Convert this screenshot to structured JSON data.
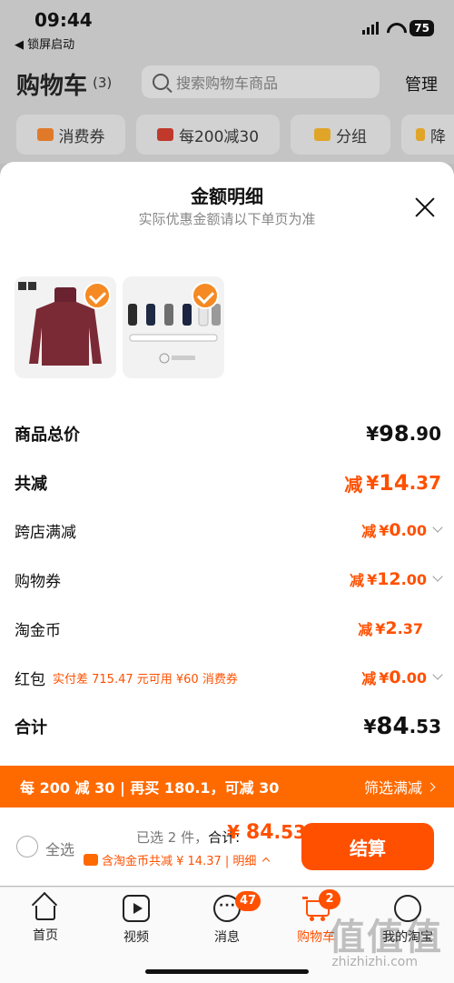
{
  "status_bar": {
    "time": "09:44",
    "battery": "75",
    "back_app": "◀ 锁屏启动"
  },
  "header": {
    "title": "购物车",
    "count": "(3)",
    "search_placeholder": "搜索购物车商品",
    "manage": "管理"
  },
  "chips": [
    "消费券",
    "每200减30",
    "分组",
    "降"
  ],
  "sheet": {
    "title": "金额明细",
    "subtitle": "实际优惠金额请以下单页为准"
  },
  "breakdown": {
    "goods_total": {
      "label": "商品总价",
      "symbol": "¥",
      "int": "98",
      "dec": ".90"
    },
    "total_discount": {
      "label": "共减",
      "prefix": "减",
      "symbol": "¥",
      "int": "14",
      "dec": ".37"
    },
    "cross_store": {
      "label": "跨店满减",
      "prefix": "减",
      "symbol": "¥",
      "int": "0",
      "dec": ".00"
    },
    "coupon": {
      "label": "购物券",
      "prefix": "减",
      "symbol": "¥",
      "int": "12",
      "dec": ".00"
    },
    "gold_coin": {
      "label": "淘金币",
      "prefix": "减",
      "symbol": "¥",
      "int": "2",
      "dec": ".37"
    },
    "hongbao": {
      "label": "红包",
      "note": "实付差 715.47 元可用 ¥60 消费券",
      "prefix": "减",
      "symbol": "¥",
      "int": "0",
      "dec": ".00"
    },
    "grand_total": {
      "label": "合计",
      "symbol": "¥",
      "int": "84",
      "dec": ".53"
    }
  },
  "promo_bar": {
    "left": "每 200 减 30 | 再买 180.1，可减 30",
    "right": "筛选满减"
  },
  "checkout": {
    "select_all": "全选",
    "selected": "已选 2 件，",
    "sum_label": "合计:",
    "total_symbol": "¥ ",
    "total_int": "84",
    "total_dec": ".53",
    "savings": "含淘金币共减 ¥ 14.37 | 明细",
    "pay": "结算"
  },
  "tabbar": {
    "items": [
      {
        "label": "首页"
      },
      {
        "label": "视频"
      },
      {
        "label": "消息",
        "badge": "47"
      },
      {
        "label": "购物车",
        "badge": "2"
      },
      {
        "label": "我的淘宝"
      }
    ]
  },
  "watermark": {
    "main": "值值值",
    "sub": "zhizhizhi.com"
  },
  "colors": {
    "accent": "#ff5000",
    "promo": "#ff6a00",
    "check": "#f58a24"
  }
}
